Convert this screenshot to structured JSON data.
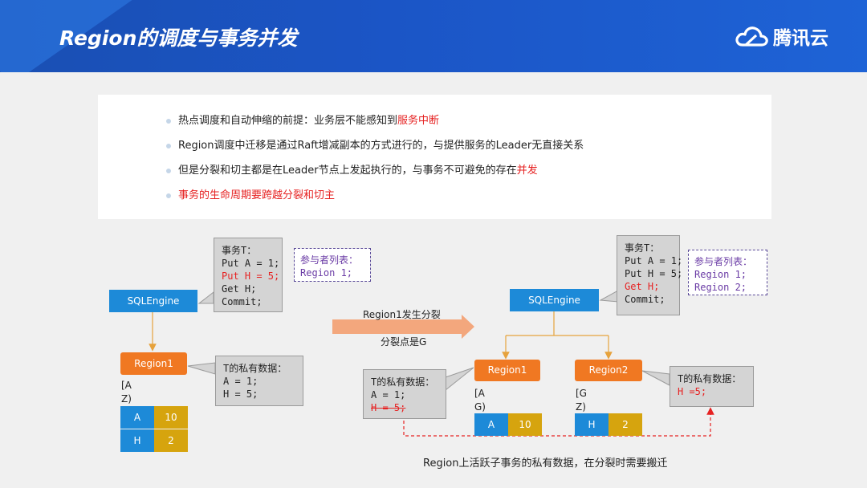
{
  "header": {
    "title": "Region的调度与事务并发",
    "logo_text": "腾讯云"
  },
  "bullets": [
    {
      "text": "热点调度和自动伸缩的前提：业务层不能感知到",
      "highlight": "服务中断"
    },
    {
      "text": "Region调度中迁移是通过Raft增减副本的方式进行的，与提供服务的Leader无直接关系",
      "highlight": ""
    },
    {
      "text": "但是分裂和切主都是在Leader节点上发起执行的，与事务不可避免的存在",
      "highlight": "并发"
    },
    {
      "text": "",
      "highlight": "事务的生命周期要跨越分裂和切主"
    }
  ],
  "left": {
    "txn": {
      "title": "事务T：",
      "line1": "Put A = 1;",
      "line2": "Put H = 5;",
      "line3": "Get H;",
      "line4": "Commit;"
    },
    "participants": {
      "title": "参与者列表：",
      "r1": "Region 1;"
    },
    "sqlengine": "SQLEngine",
    "region": "Region1",
    "range": "[A\nZ)",
    "cells": [
      {
        "k": "A",
        "v": "10"
      },
      {
        "k": "H",
        "v": "2"
      }
    ],
    "private": {
      "title": "T的私有数据：",
      "line1": "A = 1;",
      "line2": "H = 5;"
    }
  },
  "middle": {
    "arrow_label": "Region1发生分裂",
    "split_point": "分裂点是G"
  },
  "right": {
    "txn": {
      "title": "事务T：",
      "line1": "Put A = 1;",
      "line2": "Put H = 5;",
      "line3": "Get H;",
      "line4": "Commit;"
    },
    "participants": {
      "title": "参与者列表：",
      "r1": "Region 1;",
      "r2": "Region 2;"
    },
    "sqlengine": "SQLEngine",
    "region1": "Region1",
    "region2": "Region2",
    "range1": "[A\nG)",
    "range2": "[G\nZ)",
    "cell1": {
      "k": "A",
      "v": "10"
    },
    "cell2": {
      "k": "H",
      "v": "2"
    },
    "private1": {
      "title": "T的私有数据：",
      "line1": "A = 1;",
      "line2": "H = 5;"
    },
    "private2": {
      "title": "T的私有数据：",
      "line1": "H =5;"
    }
  },
  "footer_note": "Region上活跃子事务的私有数据，在分裂时需要搬迁",
  "colors": {
    "header": "#1b55c6",
    "sql": "#1d8ad8",
    "region": "#f07822",
    "value": "#d6a40e",
    "accent_red": "#e62222",
    "arrow": "#f3a77d",
    "connector": "#e6a23c"
  }
}
